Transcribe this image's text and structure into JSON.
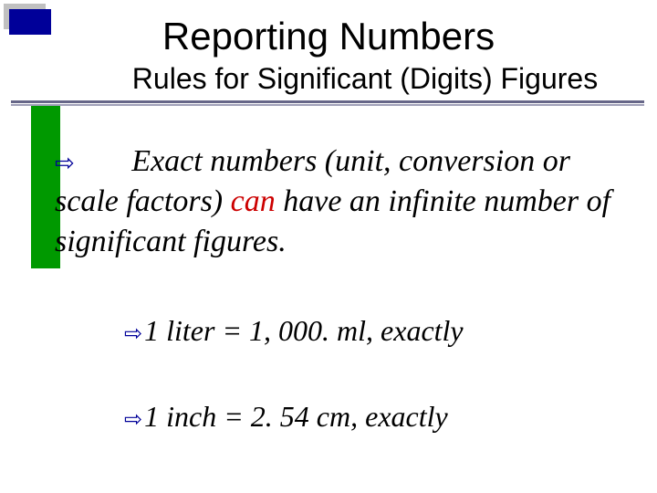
{
  "title": "Reporting Numbers",
  "subtitle": "Rules for Significant (Digits) Figures",
  "bullet": {
    "arrow": "⇨",
    "lead_indent": "     ",
    "part1": "Exact numbers (unit, conversion or scale factors) ",
    "can": "can",
    "part2": " have an infinite number of significant figures."
  },
  "sub": [
    {
      "arrow": "⇨",
      "text": "1 liter  =  1, 000. ml, exactly"
    },
    {
      "arrow": "⇨",
      "text": "1 inch  =  2. 54 cm, exactly"
    }
  ]
}
